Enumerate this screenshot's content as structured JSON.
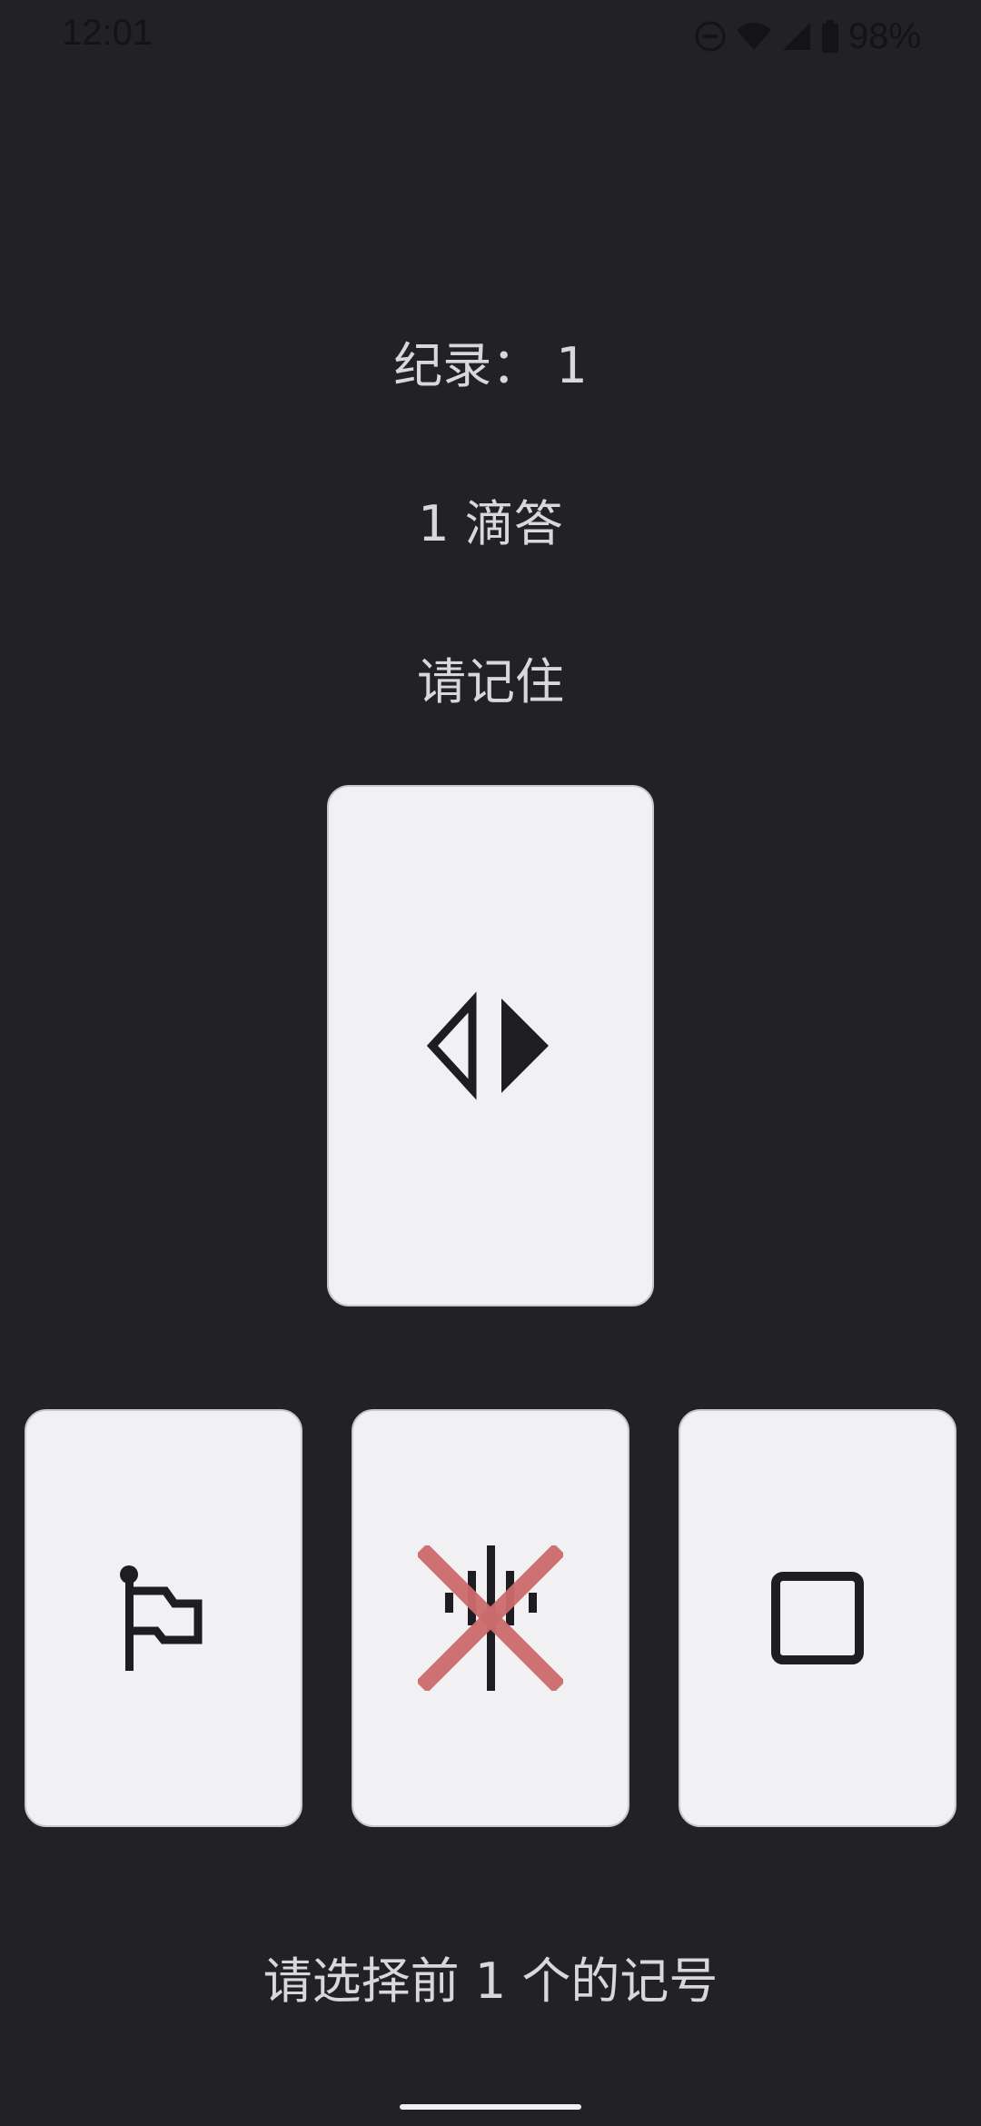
{
  "status_bar": {
    "time": "12:01",
    "battery": "98%",
    "icons": [
      "do-not-disturb-icon",
      "wifi-icon",
      "signal-icon",
      "battery-icon"
    ]
  },
  "record_label": "纪录： 1",
  "drops_label": "1 滴答",
  "remember_label": "请记住",
  "target_card": {
    "symbol": "split-diamond-icon"
  },
  "options": [
    {
      "symbol": "flag-icon",
      "crossed": false
    },
    {
      "symbol": "bars-icon",
      "crossed": true
    },
    {
      "symbol": "square-icon",
      "crossed": false
    }
  ],
  "prompt_label": "请选择前 1 个的记号",
  "colors": {
    "background": "#222124",
    "card": "#f1f0f3",
    "text": "#d8d7dc",
    "cross": "#cc6b6d",
    "symbol": "#1e1d22"
  }
}
